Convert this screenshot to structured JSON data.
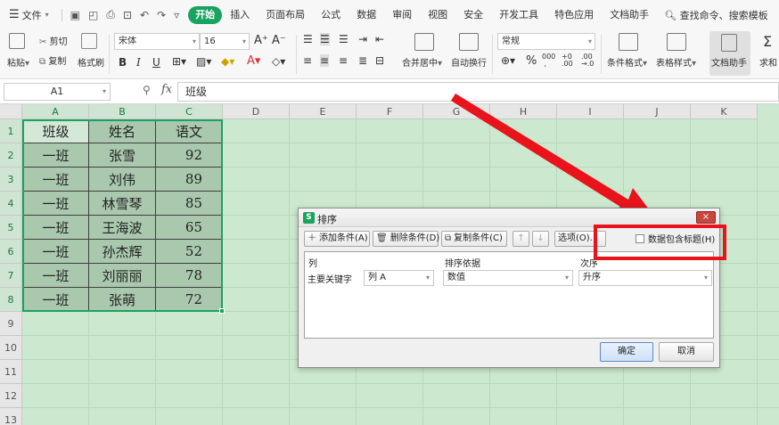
{
  "menubar": {
    "file_label": "文件",
    "tabs": [
      "开始",
      "插入",
      "页面布局",
      "公式",
      "数据",
      "审阅",
      "视图",
      "安全",
      "开发工具",
      "特色应用",
      "文档助手"
    ],
    "active_tab": "开始",
    "search_label": "查找命令、搜索模板"
  },
  "ribbon": {
    "paste": "粘贴",
    "cut": "剪切",
    "copy": "复制",
    "format_painter": "格式刷",
    "font_name": "宋体",
    "font_size": "16",
    "merge_center": "合并居中",
    "wrap_text": "自动换行",
    "number_format": "常规",
    "conditional_format": "条件格式",
    "table_style": "表格样式",
    "doc_assistant": "文档助手",
    "sum": "求和"
  },
  "formula_bar": {
    "name_box": "A1",
    "fx": "fx",
    "value": "班级"
  },
  "grid": {
    "columns": [
      "A",
      "B",
      "C",
      "D",
      "E",
      "F",
      "G",
      "H",
      "I",
      "J",
      "K"
    ],
    "rows": [
      "1",
      "2",
      "3",
      "4",
      "5",
      "6",
      "7",
      "8",
      "9",
      "10",
      "11",
      "12",
      "13"
    ],
    "table": [
      [
        "班级",
        "姓名",
        "语文"
      ],
      [
        "一班",
        "张雪",
        "92"
      ],
      [
        "一班",
        "刘伟",
        "89"
      ],
      [
        "一班",
        "林雪琴",
        "85"
      ],
      [
        "一班",
        "王海波",
        "65"
      ],
      [
        "一班",
        "孙杰辉",
        "52"
      ],
      [
        "一班",
        "刘丽丽",
        "78"
      ],
      [
        "一班",
        "张萌",
        "72"
      ]
    ]
  },
  "dialog": {
    "title": "排序",
    "logo": "S",
    "close": "×",
    "add_condition": "添加条件(A)",
    "delete_condition": "删除条件(D)",
    "copy_condition": "复制条件(C)",
    "move_up": "↑",
    "move_down": "↓",
    "options": "选项(O)...",
    "header_checkbox": "数据包含标题(H)",
    "col_header": "列",
    "sort_on_header": "排序依据",
    "order_header": "次序",
    "main_key_label": "主要关键字",
    "key_column": "列 A",
    "sort_on": "数值",
    "order": "升序",
    "ok": "确定",
    "cancel": "取消"
  },
  "colors": {
    "accent": "#1aa260",
    "sheet_background": "#cce8cf",
    "table_fill": "#a9c8ae",
    "annotation_red": "#e8131b"
  }
}
